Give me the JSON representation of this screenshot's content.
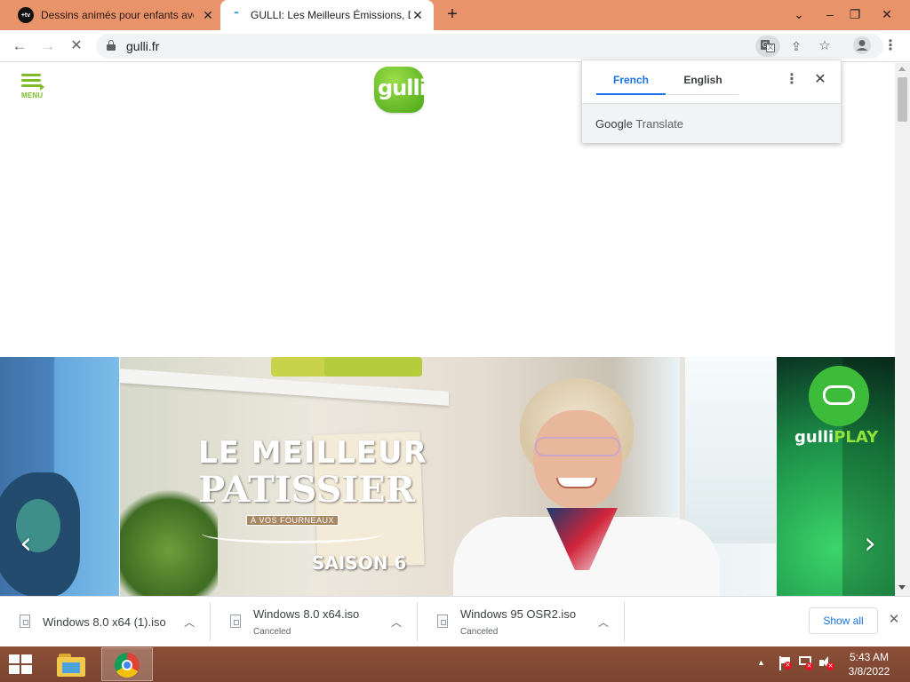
{
  "browser": {
    "tabs": [
      {
        "title": "Dessins animés pour enfants ave",
        "favicon": "tv-icon",
        "active": false
      },
      {
        "title": "GULLI: Les Meilleurs Émissions, D",
        "favicon": "loading-spinner-icon",
        "active": true
      }
    ],
    "url": "gulli.fr",
    "accent_color": "#e9936b"
  },
  "page": {
    "menu_label": "MENU",
    "logo_text": "gulli",
    "carousel": {
      "main_slide": {
        "title_line1": "LE MEILLEUR",
        "title_line2": "PATISSIER",
        "tagline": "À VOS FOURNEAUX",
        "season": "SAISON 6"
      },
      "right_slide": {
        "brand": "gulli",
        "brand_suffix": "PLAY"
      },
      "prev_arrow": "‹",
      "next_arrow": "›"
    }
  },
  "translate_popup": {
    "source_lang": "French",
    "target_lang": "English",
    "footer_google": "Google",
    "footer_translate": "Translate"
  },
  "downloads": {
    "items": [
      {
        "name": "Windows 8.0 x64 (1).iso",
        "status": ""
      },
      {
        "name": "Windows 8.0 x64.iso",
        "status": "Canceled"
      },
      {
        "name": "Windows 95 OSR2.iso",
        "status": "Canceled"
      }
    ],
    "show_all": "Show all"
  },
  "taskbar": {
    "time": "5:43 AM",
    "date": "3/8/2022"
  }
}
